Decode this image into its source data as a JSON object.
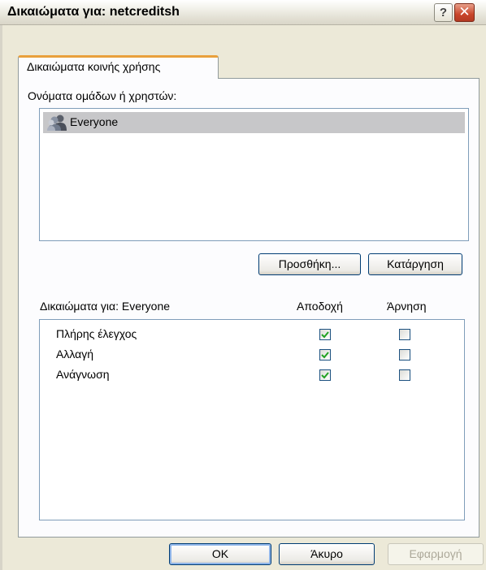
{
  "window": {
    "title": "Δικαιώματα για: netcreditsh",
    "help_glyph": "?",
    "close_glyph": "✕"
  },
  "tab": {
    "label": "Δικαιώματα κοινής χρήσης"
  },
  "users": {
    "label": "Ονόματα ομάδων ή χρηστών:",
    "items": [
      {
        "name": "Everyone",
        "icon": "users-group-icon",
        "selected": true
      }
    ],
    "add_button": "Προσθήκη...",
    "remove_button": "Κατάργηση"
  },
  "permissions": {
    "label": "Δικαιώματα για: Everyone",
    "allow_header": "Αποδοχή",
    "deny_header": "Άρνηση",
    "rows": [
      {
        "name": "Πλήρης έλεγχος",
        "allow": true,
        "deny": false
      },
      {
        "name": "Αλλαγή",
        "allow": true,
        "deny": false
      },
      {
        "name": "Ανάγνωση",
        "allow": true,
        "deny": false
      }
    ]
  },
  "footer": {
    "ok_button": "OK",
    "cancel_button": "Άκυρο",
    "apply_button": "Εφαρμογή"
  },
  "colors": {
    "tab_accent": "#e9a03c",
    "check": "#21a121",
    "button_border": "#003c74"
  }
}
